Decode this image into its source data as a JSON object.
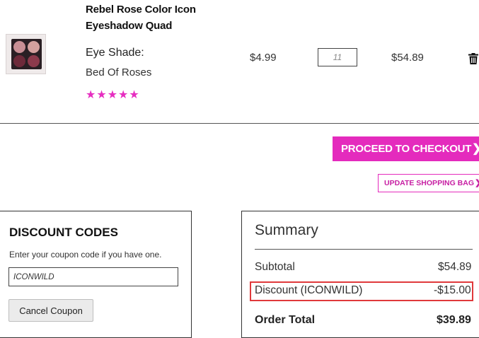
{
  "cart_item": {
    "name_line1": "Rebel Rose Color Icon",
    "name_line2": "Eyeshadow Quad",
    "shade_label": "Eye Shade:",
    "shade_value": "Bed Of Roses",
    "rating_stars": "★★★★★",
    "unit_price": "$4.99",
    "quantity": "11",
    "line_total": "$54.89",
    "delete_icon": "trash-icon"
  },
  "actions": {
    "checkout_label": "PROCEED TO CHECKOUT",
    "checkout_chevron": "❯",
    "update_bag_label": "UPDATE SHOPPING BAG",
    "update_chevron": "❯"
  },
  "discount": {
    "title": "DISCOUNT CODES",
    "hint": "Enter your coupon code if you have one.",
    "coupon_value": "ICONWILD",
    "cancel_label": "Cancel Coupon"
  },
  "summary": {
    "title": "Summary",
    "subtotal_label": "Subtotal",
    "subtotal_value": "$54.89",
    "discount_label": "Discount (ICONWILD)",
    "discount_value": "-$15.00",
    "total_label": "Order Total",
    "total_value": "$39.89"
  },
  "colors": {
    "accent": "#e42bbd",
    "highlight_box": "#e0393b"
  }
}
